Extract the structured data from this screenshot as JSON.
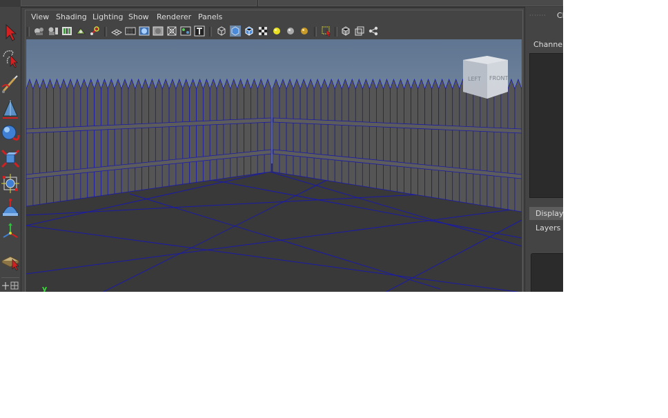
{
  "panel": {
    "menus": [
      {
        "id": "view",
        "label": "View"
      },
      {
        "id": "shading",
        "label": "Shading"
      },
      {
        "id": "lighting",
        "label": "Lighting"
      },
      {
        "id": "show",
        "label": "Show"
      },
      {
        "id": "renderer",
        "label": "Renderer"
      },
      {
        "id": "panels",
        "label": "Panels"
      }
    ]
  },
  "toolbox": {
    "tools": [
      "select-tool-icon",
      "lasso-tool-icon",
      "paint-select-tool-icon",
      "move-tool-icon",
      "rotate-tool-icon",
      "scale-tool-icon",
      "universal-manipulator-icon",
      "soft-modification-icon",
      "show-manipulator-icon",
      "last-tool-used-icon"
    ]
  },
  "viewport": {
    "view_cube": {
      "left_label": "LEFT",
      "front_label": "FRONT"
    },
    "axis_label": "y",
    "colors": {
      "sky_top": "#5f7591",
      "sky_bottom": "#a9b5c2",
      "ground": "#393939",
      "wireframe": "#1a1aa8",
      "fence": "#555555"
    }
  },
  "right_dock": {
    "title": "Ch",
    "channels_tab": "Channels",
    "display_tab": "Display",
    "layers_label": "Layers"
  }
}
